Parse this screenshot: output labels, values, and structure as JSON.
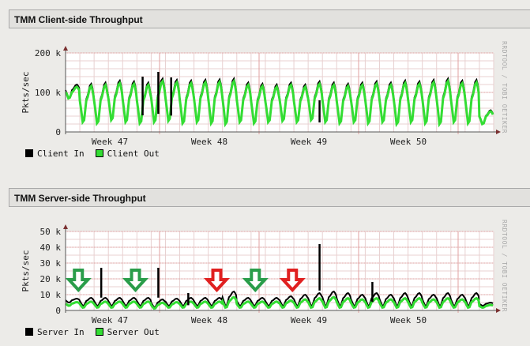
{
  "chart_data": [
    {
      "type": "line",
      "title": "TMM Client-side Throughput",
      "ylabel": "Pkts/sec",
      "ylim": [
        0,
        200000
      ],
      "yticks": [
        "0",
        "100 k",
        "200 k"
      ],
      "ytick_values": [
        0,
        100000,
        200000
      ],
      "xticks": [
        "Week 47",
        "Week 48",
        "Week 49",
        "Week 50"
      ],
      "days": 30,
      "series": [
        {
          "name": "Client In",
          "color": "#000000",
          "peaks": [
            120,
            122,
            125,
            130,
            128,
            125,
            135,
            132,
            130,
            132,
            133,
            135,
            125,
            122,
            120,
            125,
            120,
            128,
            125,
            122,
            125,
            128,
            125,
            130,
            128,
            132,
            135,
            130,
            132,
            55
          ],
          "troughs": [
            85,
            25,
            22,
            30,
            25,
            22,
            25,
            28,
            22,
            25,
            22,
            20,
            25,
            22,
            25,
            28,
            25,
            30,
            25,
            22,
            25,
            22,
            25,
            20,
            25,
            22,
            20,
            25,
            22,
            20
          ],
          "spikes": [
            {
              "day": 5.4,
              "value": 140000
            },
            {
              "day": 6.5,
              "value": 152000
            },
            {
              "day": 7.4,
              "value": 138000
            },
            {
              "day": 17.8,
              "value": 80000
            }
          ]
        },
        {
          "name": "Client Out",
          "color": "#33dd33",
          "scale": 0.95
        }
      ],
      "watermark": "RRDTOOL / TOBI OETIKER"
    },
    {
      "type": "line",
      "title": "TMM Server-side Throughput",
      "ylabel": "Pkts/sec",
      "ylim": [
        0,
        50000
      ],
      "yticks": [
        "0",
        "10 k",
        "20 k",
        "30 k",
        "40 k",
        "50 k"
      ],
      "ytick_values": [
        0,
        10000,
        20000,
        30000,
        40000,
        50000
      ],
      "xticks": [
        "Week 47",
        "Week 48",
        "Week 49",
        "Week 50"
      ],
      "days": 30,
      "series": [
        {
          "name": "Server In",
          "color": "#000000",
          "peaks": [
            7.5,
            8,
            8,
            8,
            8,
            8,
            7,
            7.5,
            8,
            8,
            8,
            12,
            8,
            8,
            8,
            9,
            10,
            11,
            12,
            11,
            10,
            11,
            10,
            11,
            11,
            10,
            11,
            10,
            11,
            5
          ],
          "troughs": [
            5,
            3,
            3,
            3,
            3,
            3,
            2,
            3,
            3,
            3,
            3,
            3,
            3,
            3,
            3,
            3,
            3,
            3,
            3,
            3,
            3,
            3,
            3,
            3,
            3,
            3,
            3,
            3,
            3,
            3
          ],
          "spikes": [
            {
              "day": 2.5,
              "value": 27000
            },
            {
              "day": 6.5,
              "value": 27000
            },
            {
              "day": 17.8,
              "value": 42000
            },
            {
              "day": 21.5,
              "value": 18000
            },
            {
              "day": 8.6,
              "value": 11000
            }
          ]
        },
        {
          "name": "Server Out",
          "color": "#33dd33",
          "scale": 0.65
        }
      ],
      "annotations": [
        {
          "type": "green-down-arrow",
          "day": 0.9
        },
        {
          "type": "green-down-arrow",
          "day": 4.9
        },
        {
          "type": "red-down-arrow",
          "day": 10.6
        },
        {
          "type": "green-down-arrow",
          "day": 13.3
        },
        {
          "type": "red-down-arrow",
          "day": 15.9
        }
      ],
      "watermark": "RRDTOOL / TOBI OETIKER"
    }
  ]
}
